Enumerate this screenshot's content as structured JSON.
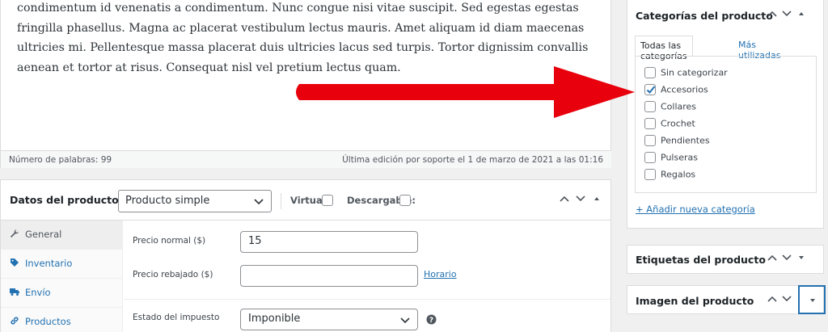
{
  "editor": {
    "text": "condimentum id venenatis a condimentum. Nunc congue nisi vitae suscipit. Sed egestas egestas fringilla phasellus. Magna ac placerat vestibulum lectus mauris. Amet aliquam id diam maecenas ultricies mi. Pellentesque massa placerat duis ultricies lacus sed turpis. Tortor dignissim convallis aenean et tortor at risus. Consequat nisl vel pretium lectus quam.",
    "word_count": "Número de palabras: 99",
    "last_edit": "Última edición por soporte el 1 de marzo de 2021 a las 01:16"
  },
  "product_data": {
    "title": "Datos del producto —",
    "type_value": "Producto simple",
    "virtual_label": "Virtual:",
    "downloadable_label": "Descargable:",
    "tabs": [
      {
        "label": "General",
        "icon": "wrench-icon"
      },
      {
        "label": "Inventario",
        "icon": "tag-icon"
      },
      {
        "label": "Envío",
        "icon": "truck-icon"
      },
      {
        "label": "Productos",
        "icon": "link-icon"
      }
    ],
    "regular_price_label": "Precio normal ($)",
    "regular_price_value": "15",
    "sale_price_label": "Precio rebajado ($)",
    "sale_price_value": "",
    "schedule_link": "Horario",
    "tax_status_label": "Estado del impuesto",
    "tax_status_value": "Imponible"
  },
  "categories_box": {
    "title": "Categorías del producto",
    "tab_all": "Todas las categorías",
    "tab_most_used": "Más utilizadas",
    "items": [
      {
        "label": "Sin categorizar",
        "checked": false
      },
      {
        "label": "Accesorios",
        "checked": true
      },
      {
        "label": "Collares",
        "checked": false
      },
      {
        "label": "Crochet",
        "checked": false
      },
      {
        "label": "Pendientes",
        "checked": false
      },
      {
        "label": "Pulseras",
        "checked": false
      },
      {
        "label": "Regalos",
        "checked": false
      }
    ],
    "add_new": "+ Añadir nueva categoría"
  },
  "tags_box": {
    "title": "Etiquetas del producto"
  },
  "image_box": {
    "title": "Imagen del producto"
  },
  "colors": {
    "link": "#2271b1",
    "arrow": "#e8000c",
    "check": "#2271b1"
  }
}
